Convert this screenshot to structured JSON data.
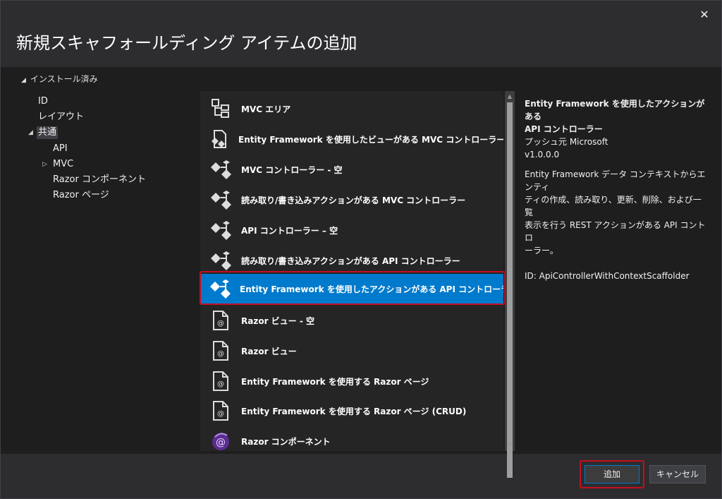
{
  "dialog": {
    "title": "新規スキャフォールディング アイテムの追加",
    "close_label": "✕"
  },
  "sidebar": {
    "installed_label": "インストール済み",
    "items": [
      {
        "label": "ID"
      },
      {
        "label": "レイアウト"
      },
      {
        "label": "共通"
      },
      {
        "label": "API"
      },
      {
        "label": "MVC"
      },
      {
        "label": "Razor コンポーネント"
      },
      {
        "label": "Razor ページ"
      }
    ]
  },
  "templates": {
    "items": [
      {
        "label": "MVC エリア",
        "icon": "area-icon"
      },
      {
        "label": "Entity Framework を使用したビューがある MVC コントローラー",
        "icon": "controller-views-icon"
      },
      {
        "label": "MVC コントローラー - 空",
        "icon": "controller-icon"
      },
      {
        "label": "読み取り/書き込みアクションがある MVC コントローラー",
        "icon": "controller-icon"
      },
      {
        "label": "API コントローラー – 空",
        "icon": "controller-icon"
      },
      {
        "label": "読み取り/書き込みアクションがある API コントローラー",
        "icon": "controller-icon"
      },
      {
        "label": "Entity Framework を使用したアクションがある API コントローラー",
        "icon": "controller-icon",
        "selected": true
      },
      {
        "label": "Razor ビュー - 空",
        "icon": "razor-page-icon"
      },
      {
        "label": "Razor ビュー",
        "icon": "razor-page-icon"
      },
      {
        "label": "Entity Framework を使用する Razor ページ",
        "icon": "razor-page-icon"
      },
      {
        "label": "Entity Framework を使用する Razor ページ (CRUD)",
        "icon": "razor-page-icon"
      },
      {
        "label": "Razor コンポーネント",
        "icon": "blazor-icon"
      }
    ]
  },
  "details": {
    "name_line1": "Entity Framework を使用したアクションがある",
    "name_line2": "API コントローラー",
    "publisher": "プッシュ元 Microsoft",
    "version": "v1.0.0.0",
    "description_lines": [
      "Entity Framework データ コンテキストからエンティ",
      "ティの作成、読み取り、更新、削除、および一覧",
      "表示を行う REST アクションがある API コントロ",
      "ーラー。"
    ],
    "id_line": "ID: ApiControllerWithContextScaffolder"
  },
  "buttons": {
    "add_label": "追加",
    "cancel_label": "キャンセル"
  },
  "colors": {
    "accent": "#007acc",
    "highlight": "#c50f1f"
  }
}
